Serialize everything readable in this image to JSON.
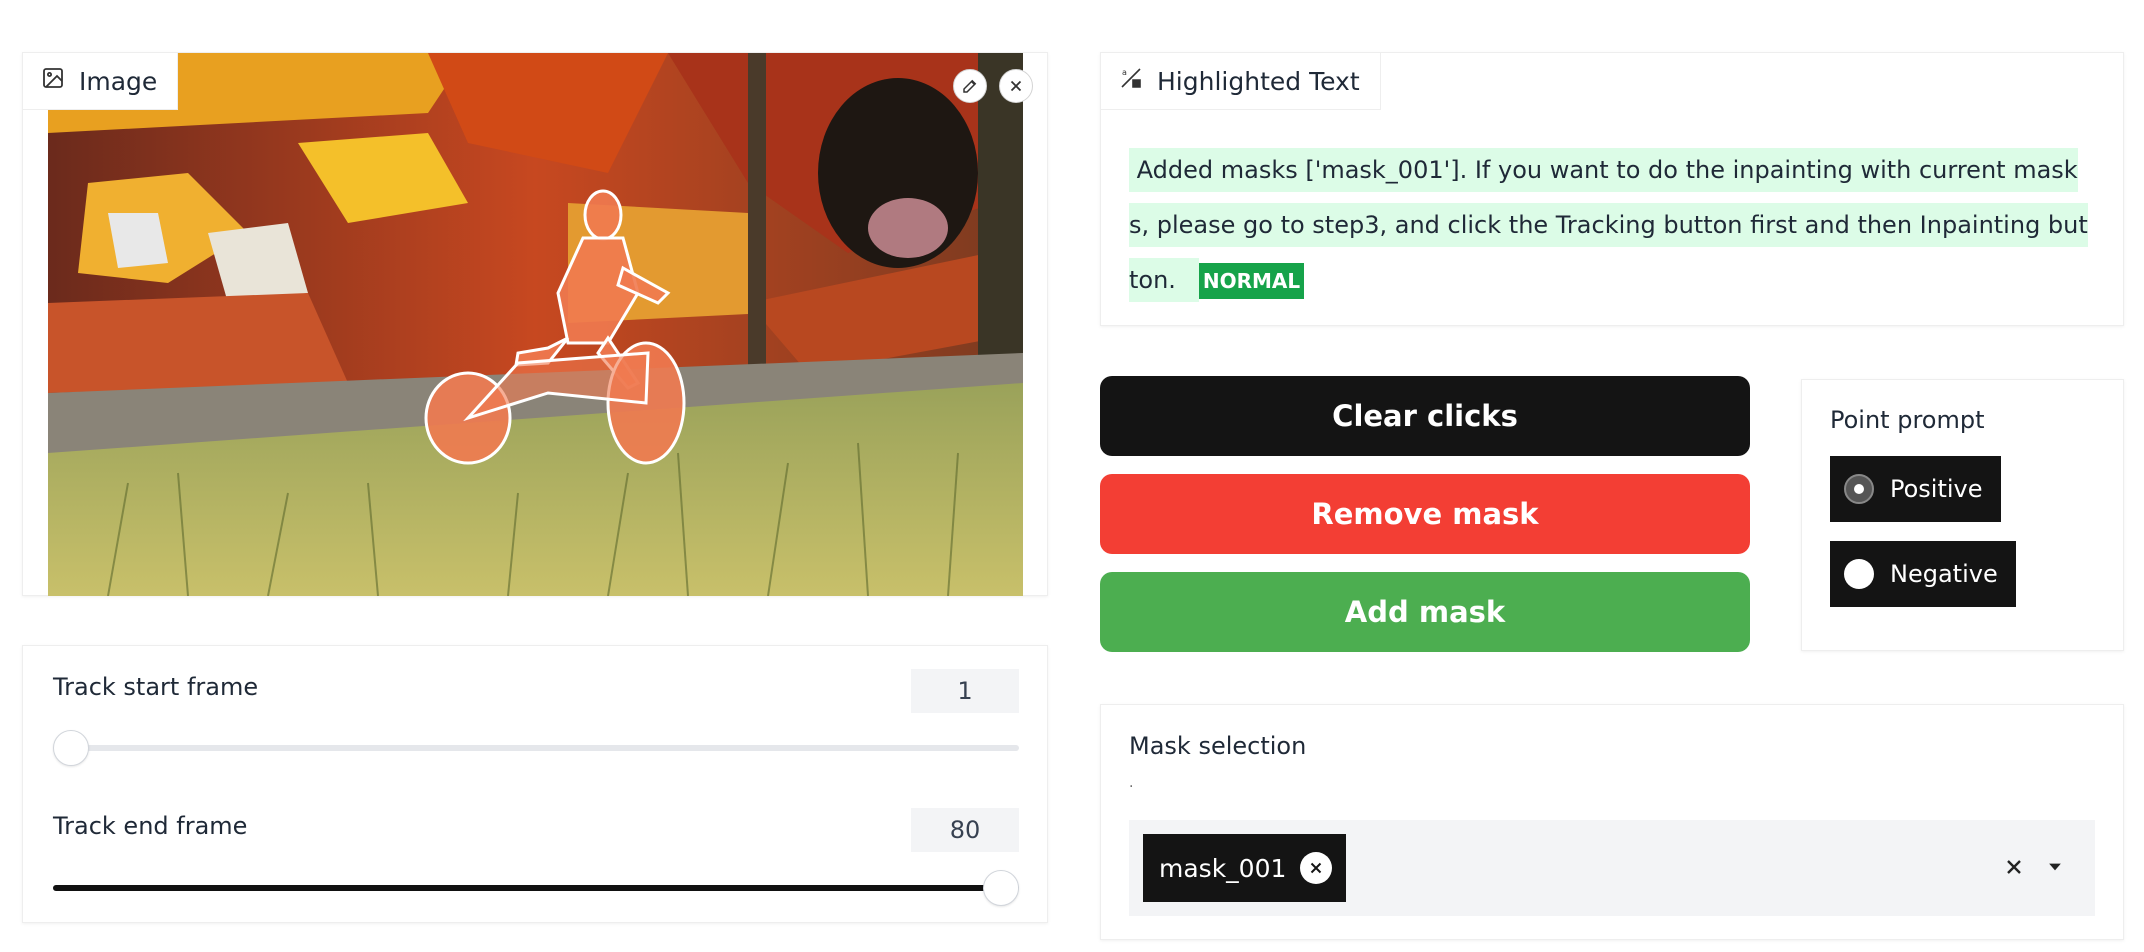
{
  "image_block": {
    "label": "Image",
    "label_icon": "image-icon",
    "edit_icon": "pencil-icon",
    "close_icon": "close-icon"
  },
  "sliders": {
    "start": {
      "label": "Track start frame",
      "value": "1",
      "fraction": 0.0
    },
    "end": {
      "label": "Track end frame",
      "value": "80",
      "fraction": 1.0
    }
  },
  "highlighted": {
    "label": "Highlighted Text",
    "label_icon": "highlight-text-icon",
    "text": "Added masks ['mask_001']. If you want to do the inpainting with current masks, please go to step3, and click the Tracking button first and then Inpainting button.",
    "tag": "NORMAL"
  },
  "buttons": {
    "clear": "Clear clicks",
    "remove": "Remove mask",
    "add": "Add mask"
  },
  "point_prompt": {
    "label": "Point prompt",
    "options": [
      "Positive",
      "Negative"
    ],
    "selected": "Positive"
  },
  "mask_selection": {
    "label": "Mask selection",
    "hint": ".",
    "chips": [
      "mask_001"
    ]
  },
  "colors": {
    "dark": "#141414",
    "remove": "#f33e34",
    "add": "#4cae50",
    "highlight_bg": "#dcfce7",
    "tag_bg": "#16a34a",
    "mask_overlay": "#f07a50"
  }
}
